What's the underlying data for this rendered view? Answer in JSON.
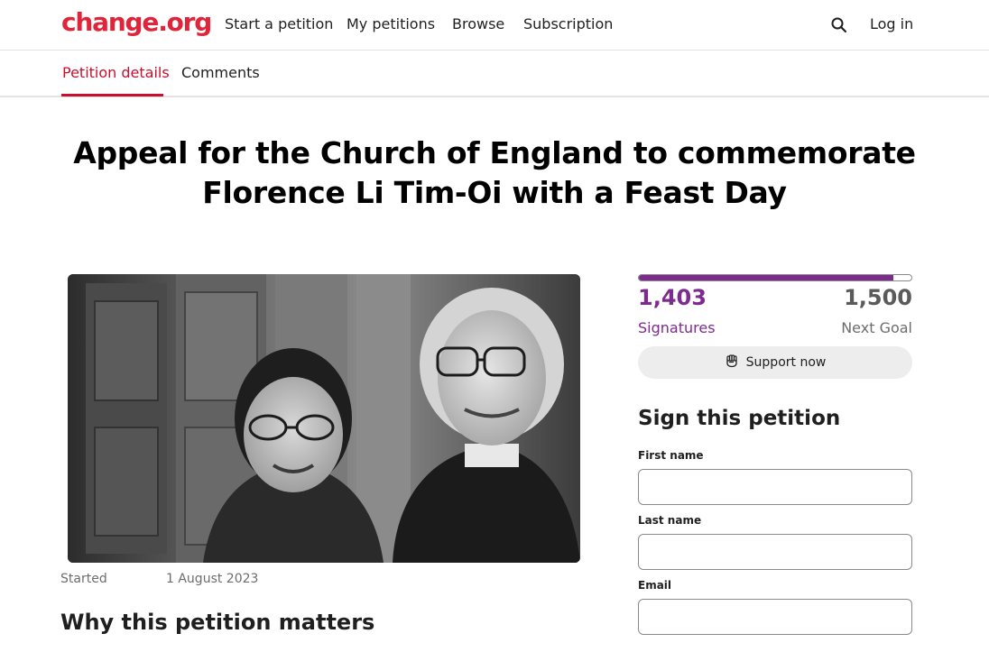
{
  "brand": {
    "logo": "change.org",
    "color": "#e0243a"
  },
  "nav": {
    "links": [
      "Start a petition",
      "My petitions",
      "Browse",
      "Subscription"
    ],
    "search_icon": "search-icon",
    "login": "Log in"
  },
  "tabs": {
    "items": [
      "Petition details",
      "Comments"
    ],
    "active_color": "#c8102e"
  },
  "petition": {
    "title": "Appeal for the Church of England to commemorate Florence Li Tim-Oi with a Feast Day",
    "started_label": "Started",
    "started_date": "1 August 2023",
    "why_heading": "Why this petition matters"
  },
  "signatures": {
    "count": "1,403",
    "count_label": "Signatures",
    "goal": "1,500",
    "goal_label": "Next Goal",
    "progress_fraction": 0.935,
    "accent_color": "#7e2b8e"
  },
  "support": {
    "label": "Support now",
    "icon": "fist-icon"
  },
  "sign_form": {
    "heading": "Sign this petition",
    "first_name_label": "First name",
    "last_name_label": "Last name",
    "email_label": "Email"
  }
}
